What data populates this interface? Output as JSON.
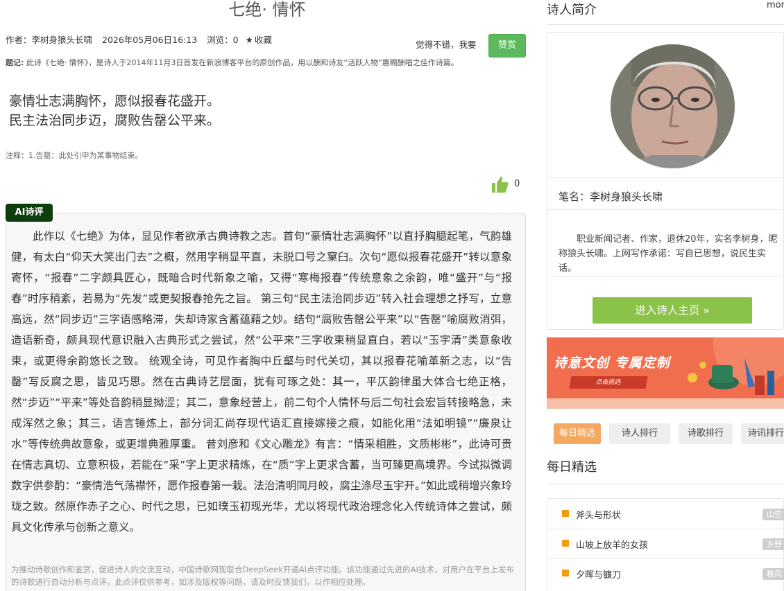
{
  "poem": {
    "title": "七绝· 情怀",
    "author": "作者：李树身狼头长啸",
    "datetime": "2026年05月06日16:13",
    "views": "浏览：0",
    "favorite": "收藏",
    "praise_prompt": "觉得不错，我要",
    "praise_button": "赞赏",
    "inscription_label": "题记:",
    "inscription": "此诗《七绝· 情怀》，是诗人于2014年11月3日首发在新浪博客平台的原创作品，用以酬和诗友“活跃人物”惠赐酬唱之佳作诗篇。",
    "lines": [
      "豪情壮志满胸怀，愿似报春花盛开。",
      "民主法治同步迈，腐败告罄公平来。"
    ],
    "note": "注释：1.告罄：此处引申为某事物结束。",
    "like_count": "0"
  },
  "ai_review": {
    "badge": "AI诗评",
    "text": "此作以《七绝》为体，显见作者欲承古典诗教之志。首句“豪情壮志满胸怀”以直抒胸臆起笔，气韵雄健，有太白“仰天大笑出门去”之概，然用字稍显平直，未脱口号之窠臼。次句“愿似报春花盛开”转以意象寄怀，“报春”二字颇具匠心，既暗合时代新象之喻，又得“寒梅报春”传统意象之余韵，唯“盛开”与“报春”时序稍紊，若易为“先发”或更契报春抢先之旨。 第三句“民主法治同步迈”转入社会理想之抒写，立意高远，然“同步迈”三字语感略滞，失却诗家含蓄蕴藉之妙。结句“腐败告罄公平来”以“告罄”喻腐败消弭，造语新奇，颇具现代意识融入古典形式之尝试，然“公平来”三字收束稍显直白，若以“玉宇清”类意象收束，或更得余韵悠长之致。 统观全诗，可见作者胸中丘壑与时代关切，其以报春花喻革新之志，以“告罄”写反腐之思，皆见巧思。然在古典诗艺层面，犹有可琢之处：其一，平仄韵律虽大体合七绝正格，然“步迈”“平来”等处音韵稍显拗涩；其二，意象经营上，前二句个人情怀与后二句社会宏旨转接略急，未成浑然之象；其三，语言锤炼上，部分词汇尚存现代语汇直接嫁接之痕，如能化用“法如明镜”“廉泉让水”等传统典故意象，或更增典雅厚重。 昔刘彦和《文心雕龙》有言：“情采相胜，文质彬彬”，此诗可贵在情志真切、立意积极，若能在“采”字上更求精炼，在“质”字上更求含蓄，当可臻更高境界。今试拟微调数字供参酌：“豪情浩气荡襟怀，愿作报春第一栽。法治清明同月皎，腐尘涤尽玉宇开。”如此或稍增兴象玲珑之致。然原作赤子之心、时代之思，已如璞玉初现光华，尤以将现代政治理念化入传统诗体之尝试，颇具文化传承与创新之意义。",
    "footnote": "为推动诗歌创作和鉴赏，促进诗人的交流互动，中国诗歌网现联合DeepSeek开通AI点评功能。该功能通过先进的AI技术，对用户在平台上发布的诗歌进行自动分析与点评。此点评仅供参考，如涉及版权等问题，请及时反馈我们，以作相应处理。"
  },
  "sidebar": {
    "intro_title": "诗人简介",
    "more": "more",
    "pen_name": "笔名：李树身狼头长啸",
    "bio": "职业新闻记者、作家，退休20年，实名李树身，昵称狼头长啸。上网写作承诺：写自已思想，说民生实话。",
    "home_button": "进入诗人主页 »",
    "banner_title": "诗意文创  专属定制",
    "banner_sub": "点击挑选",
    "tabs": [
      "每日精选",
      "诗人排行",
      "诗歌排行",
      "诗讯排行"
    ],
    "daily_title": "每日精选",
    "daily_items": [
      {
        "title": "斧头与形状",
        "tag": "山空"
      },
      {
        "title": "山坡上放羊的女孩",
        "tag": "乡野"
      },
      {
        "title": "夕晖与镰刀",
        "tag": "稚风"
      }
    ],
    "colors": {
      "praise": "#5cb85c",
      "home": "#8bc34a",
      "active_tab": "#f5a860",
      "bullet": "#f39c12",
      "badge": "#0d3d0d"
    }
  }
}
